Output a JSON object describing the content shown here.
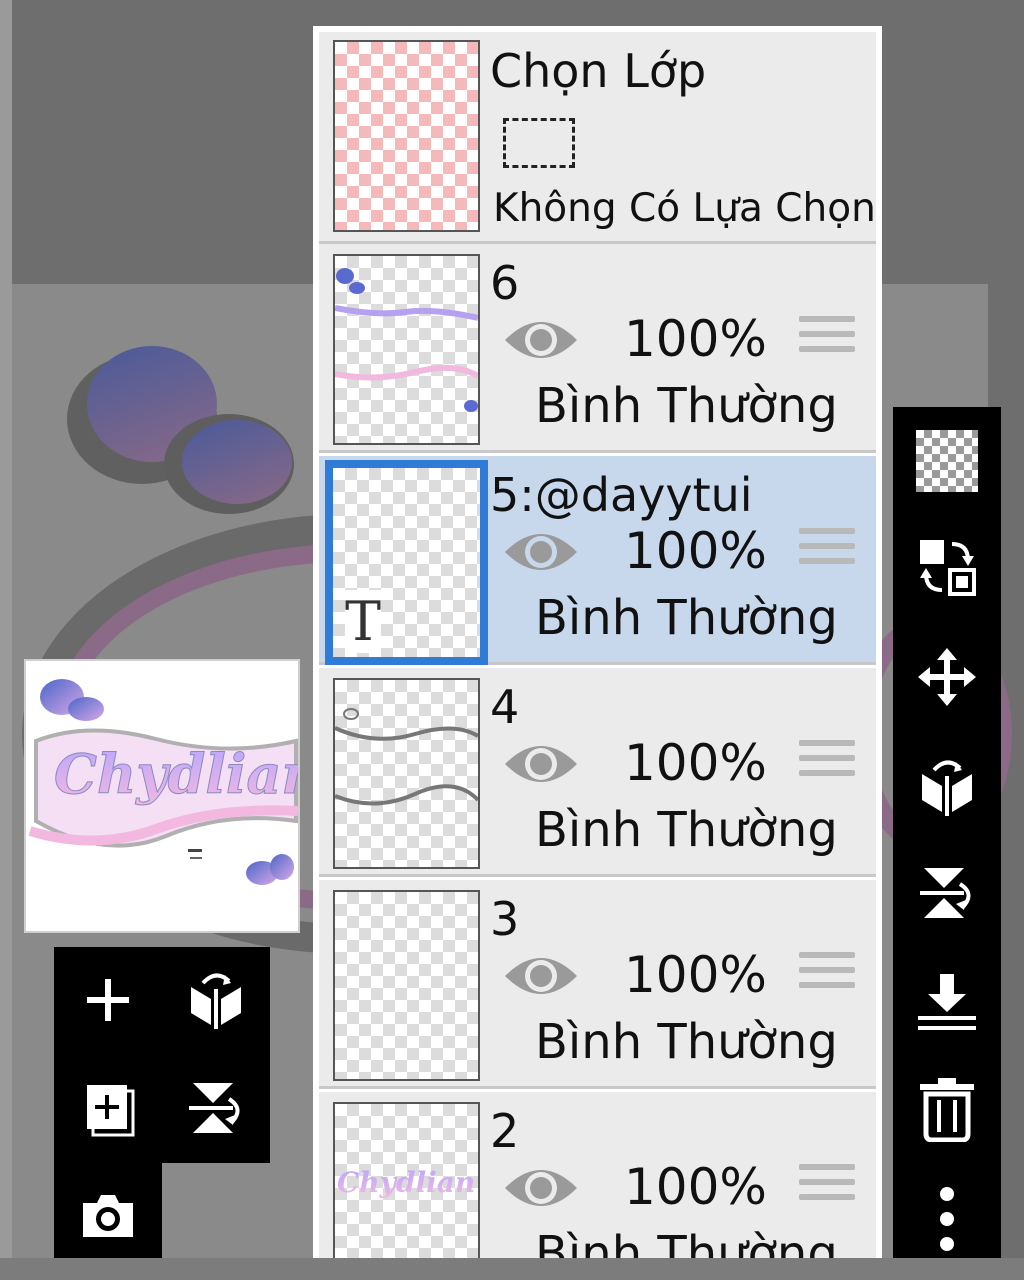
{
  "colors": {
    "panel_bg": "#ebebeb",
    "selected_row": "#c8d8ec",
    "selected_border": "#2f7bd6",
    "toolbar_bg": "#000000"
  },
  "selection_row": {
    "title": "Chọn Lớp",
    "status": "Không Có Lựa Chọn"
  },
  "layers": [
    {
      "name": "6",
      "opacity": "100%",
      "blend_mode": "Bình Thường",
      "visible": true,
      "selected": false
    },
    {
      "name": "5:@dayytui",
      "opacity": "100%",
      "blend_mode": "Bình Thường",
      "visible": true,
      "selected": true,
      "text_layer_glyph": "T"
    },
    {
      "name": "4",
      "opacity": "100%",
      "blend_mode": "Bình Thường",
      "visible": true,
      "selected": false
    },
    {
      "name": "3",
      "opacity": "100%",
      "blend_mode": "Bình Thường",
      "visible": true,
      "selected": false
    },
    {
      "name": "2",
      "opacity": "100%",
      "blend_mode": "Bình Thường",
      "visible": true,
      "selected": false
    }
  ],
  "left_toolbar": [
    "add-layer-icon",
    "flip-horizontal-icon",
    "duplicate-layer-icon",
    "flip-vertical-icon",
    "camera-icon"
  ],
  "right_toolbar": [
    "transparency-icon",
    "swap-layer-icon",
    "move-icon",
    "flip-horizontal-icon",
    "flip-vertical-icon",
    "merge-down-icon",
    "delete-icon",
    "more-icon"
  ]
}
